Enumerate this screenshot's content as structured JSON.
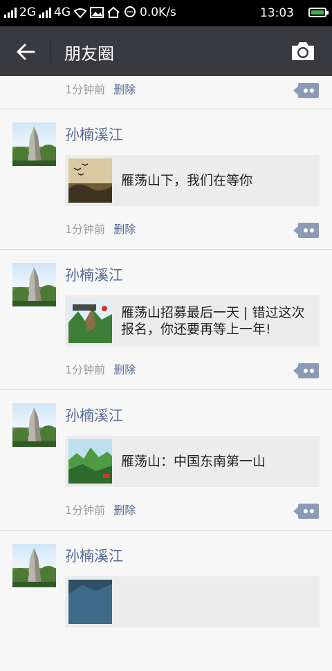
{
  "status_bar": {
    "net_2g": "2G",
    "net_4g": "4G",
    "speed": "0.0K/s",
    "time": "13:03"
  },
  "header": {
    "title": "朋友圈"
  },
  "top_partial": {
    "time": "1分钟前",
    "delete_label": "删除"
  },
  "posts": [
    {
      "author": "孙楠溪江",
      "link_title": "雁荡山下，我们在等你",
      "time": "1分钟前",
      "delete_label": "删除",
      "thumb_icon": "birds-sunset-thumbnail"
    },
    {
      "author": "孙楠溪江",
      "link_title": "雁荡山招募最后一天 | 错过这次报名，你还要再等上一年!",
      "time": "1分钟前",
      "delete_label": "删除",
      "thumb_icon": "yandang-mountain-poster-thumbnail"
    },
    {
      "author": "孙楠溪江",
      "link_title": "雁荡山：中国东南第一山",
      "time": "1分钟前",
      "delete_label": "删除",
      "thumb_icon": "green-mountain-thumbnail"
    },
    {
      "author": "孙楠溪江",
      "link_title": "",
      "time": "",
      "delete_label": "",
      "thumb_icon": "blue-landscape-thumbnail"
    }
  ],
  "colors": {
    "topbar": "#393a3f",
    "link_blue": "#576b95",
    "card_bg": "#ececec",
    "battery": "#39b54a"
  }
}
